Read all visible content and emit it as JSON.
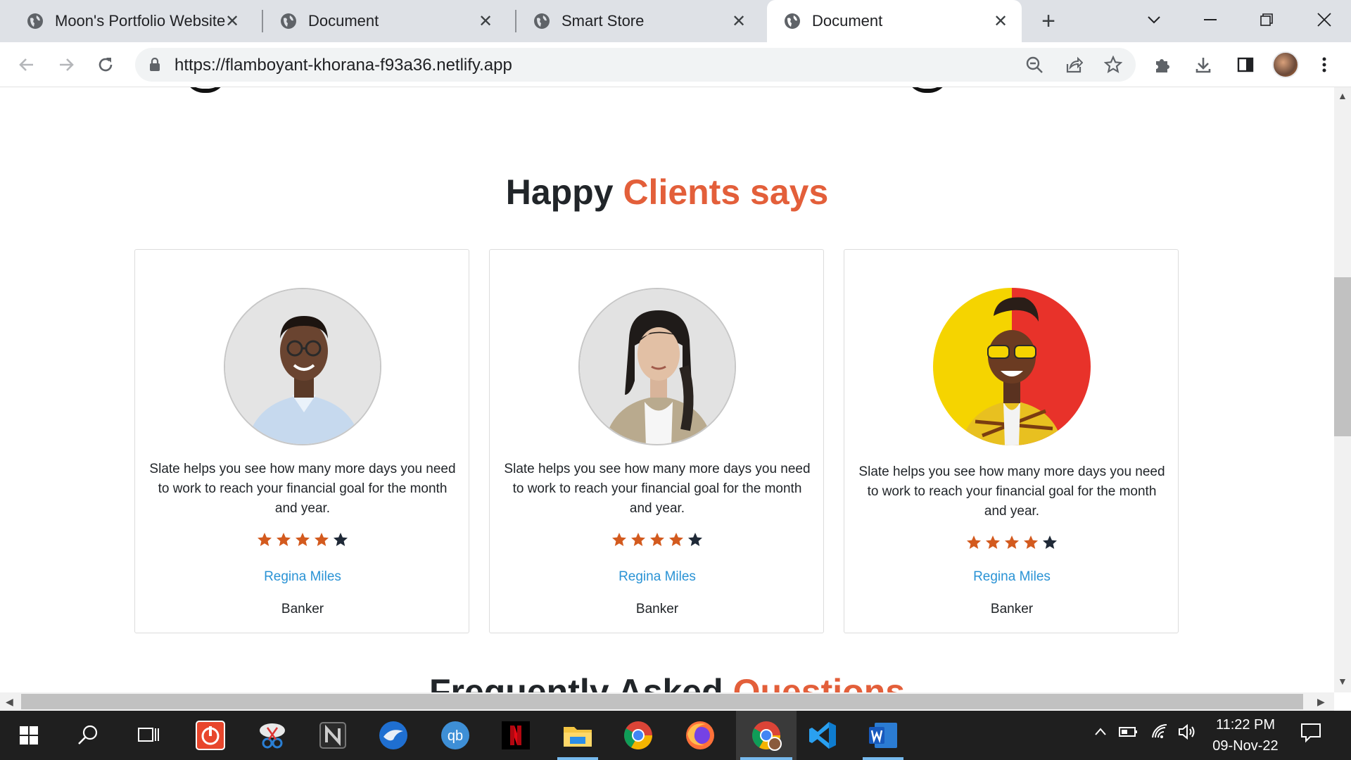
{
  "browser": {
    "tabs": [
      {
        "title": "Moon's Portfolio Website"
      },
      {
        "title": "Document"
      },
      {
        "title": "Smart Store"
      },
      {
        "title": "Document"
      }
    ],
    "url": "https://flamboyant-khorana-f93a36.netlify.app"
  },
  "testimonials": {
    "title_main": "Happy",
    "title_accent": "Clients says",
    "cards": [
      {
        "quote": "Slate helps you see how many more days you need to work to reach your financial goal for the month and year.",
        "rating": 4,
        "max_rating": 5,
        "name": "Regina Miles",
        "role": "Banker"
      },
      {
        "quote": "Slate helps you see how many more days you need to work to reach your financial goal for the month and year.",
        "rating": 4,
        "max_rating": 5,
        "name": "Regina Miles",
        "role": "Banker"
      },
      {
        "quote": "Slate helps you see how many more days you need to work to reach your financial goal for the month and year.",
        "rating": 4,
        "max_rating": 5,
        "name": "Regina Miles",
        "role": "Banker"
      }
    ]
  },
  "faq": {
    "title_main": "Frequently Asked",
    "title_accent": "Questions"
  },
  "taskbar": {
    "apps": [
      "windows-start-icon",
      "search-icon",
      "task-view-icon",
      "power-app-icon",
      "snipping-tool-icon",
      "notion-icon",
      "thunderbird-icon",
      "qbittorrent-icon",
      "netflix-icon",
      "file-explorer-icon",
      "chrome-icon",
      "firefox-icon",
      "chrome-profile-icon",
      "vscode-icon",
      "word-icon"
    ],
    "qb_label": "qb",
    "time": "11:22 PM",
    "date": "09-Nov-22"
  },
  "colors": {
    "accent": "#e35f3a",
    "link": "#2a93d5",
    "star_filled": "#d35a1e",
    "star_empty": "#1f2937"
  }
}
